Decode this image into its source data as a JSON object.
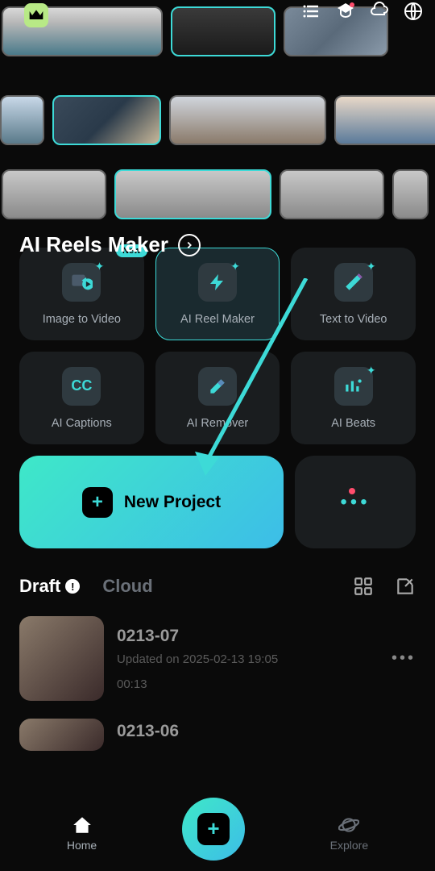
{
  "header": {
    "section_title": "AI Reels Maker"
  },
  "features": {
    "image_to_video": {
      "label": "Image to Video",
      "badge": "New"
    },
    "ai_reel_maker": {
      "label": "AI Reel Maker"
    },
    "text_to_video": {
      "label": "Text to Video"
    },
    "ai_captions": {
      "label": "AI Captions",
      "icon_text": "CC"
    },
    "ai_remover": {
      "label": "AI Remover"
    },
    "ai_beats": {
      "label": "AI Beats"
    }
  },
  "actions": {
    "new_project": "New Project"
  },
  "tabs": {
    "draft": "Draft",
    "cloud": "Cloud"
  },
  "drafts": [
    {
      "title": "0213-07",
      "updated": "Updated on 2025-02-13 19:05",
      "duration": "00:13"
    },
    {
      "title": "0213-06",
      "updated": "",
      "duration": ""
    }
  ],
  "nav": {
    "home": "Home",
    "explore": "Explore"
  }
}
